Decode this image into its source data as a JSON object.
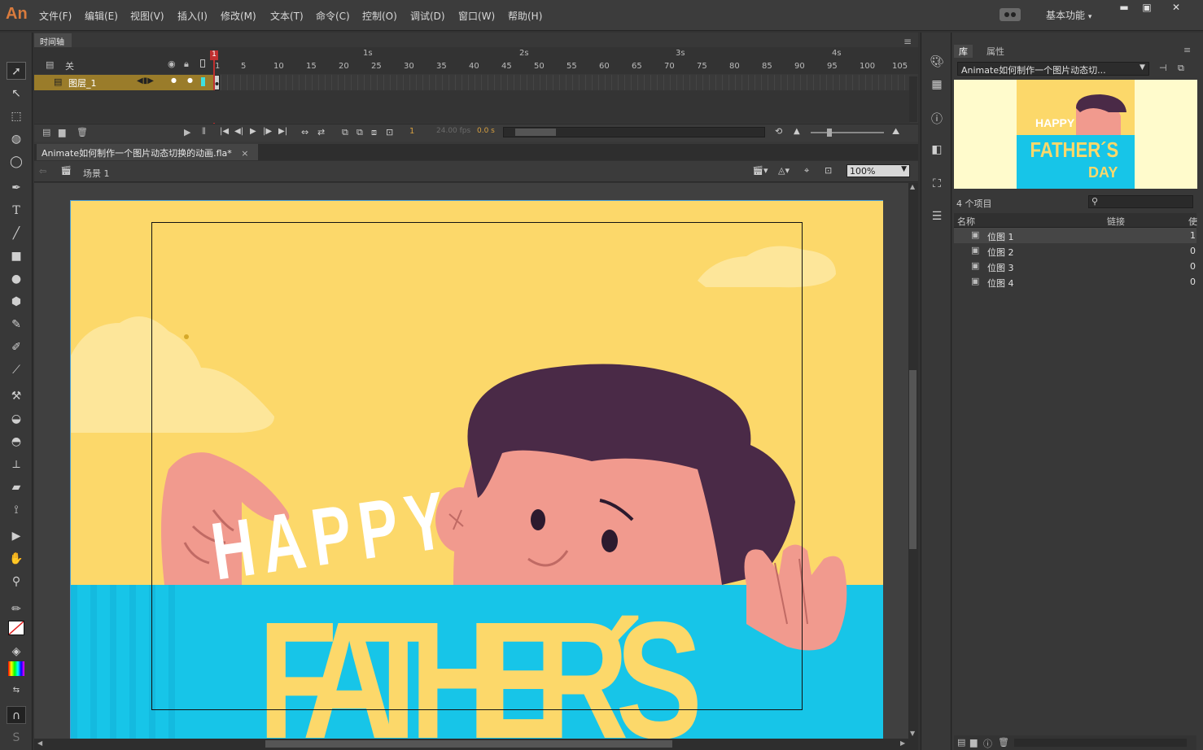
{
  "app": {
    "logo": "An"
  },
  "menu": [
    "文件(F)",
    "编辑(E)",
    "视图(V)",
    "插入(I)",
    "修改(M)",
    "文本(T)",
    "命令(C)",
    "控制(O)",
    "调试(D)",
    "窗口(W)",
    "帮助(H)"
  ],
  "workspace": {
    "label": "基本功能",
    "caret": "▾"
  },
  "window_controls": {
    "minimize": "▬",
    "restore": "▣",
    "close": "✕"
  },
  "timeline": {
    "tab": "时间轴",
    "header_label": "关",
    "layer_name": "图层_1",
    "seconds": [
      "1s",
      "2s",
      "3s",
      "4s"
    ],
    "frame_ticks": [
      "1",
      "5",
      "10",
      "15",
      "20",
      "25",
      "30",
      "35",
      "40",
      "45",
      "50",
      "55",
      "60",
      "65",
      "70",
      "75",
      "80",
      "85",
      "90",
      "95",
      "100",
      "105"
    ],
    "current_frame": "1",
    "fps": "24.00 fps",
    "elapsed": "0.0 s"
  },
  "document": {
    "tab_title": "Animate如何制作一个图片动态切换的动画.fla*",
    "close": "×",
    "scene": "场景 1",
    "zoom": "100%"
  },
  "stage_art": {
    "word1": "HAPPY",
    "word2": "FATHER´S"
  },
  "library": {
    "tab_library": "库",
    "tab_properties": "属性",
    "dropdown": "Animate如何制作一个图片动态切...",
    "preview_word1": "HAPPY",
    "preview_word2": "FATHER´S",
    "preview_word3": "DAY",
    "item_count": "4 个项目",
    "col_name": "名称",
    "col_link": "链接",
    "col_use": "使",
    "items": [
      {
        "name": "位图 1",
        "count": "1"
      },
      {
        "name": "位图 2",
        "count": "0"
      },
      {
        "name": "位图 3",
        "count": "0"
      },
      {
        "name": "位图 4",
        "count": "0"
      }
    ]
  },
  "colors": {
    "stage_yellow": "#fcd86a",
    "stage_blue": "#17c5e8",
    "hair": "#4a2a47",
    "skin": "#f19a8e",
    "layer_row": "#9a7c2a"
  }
}
